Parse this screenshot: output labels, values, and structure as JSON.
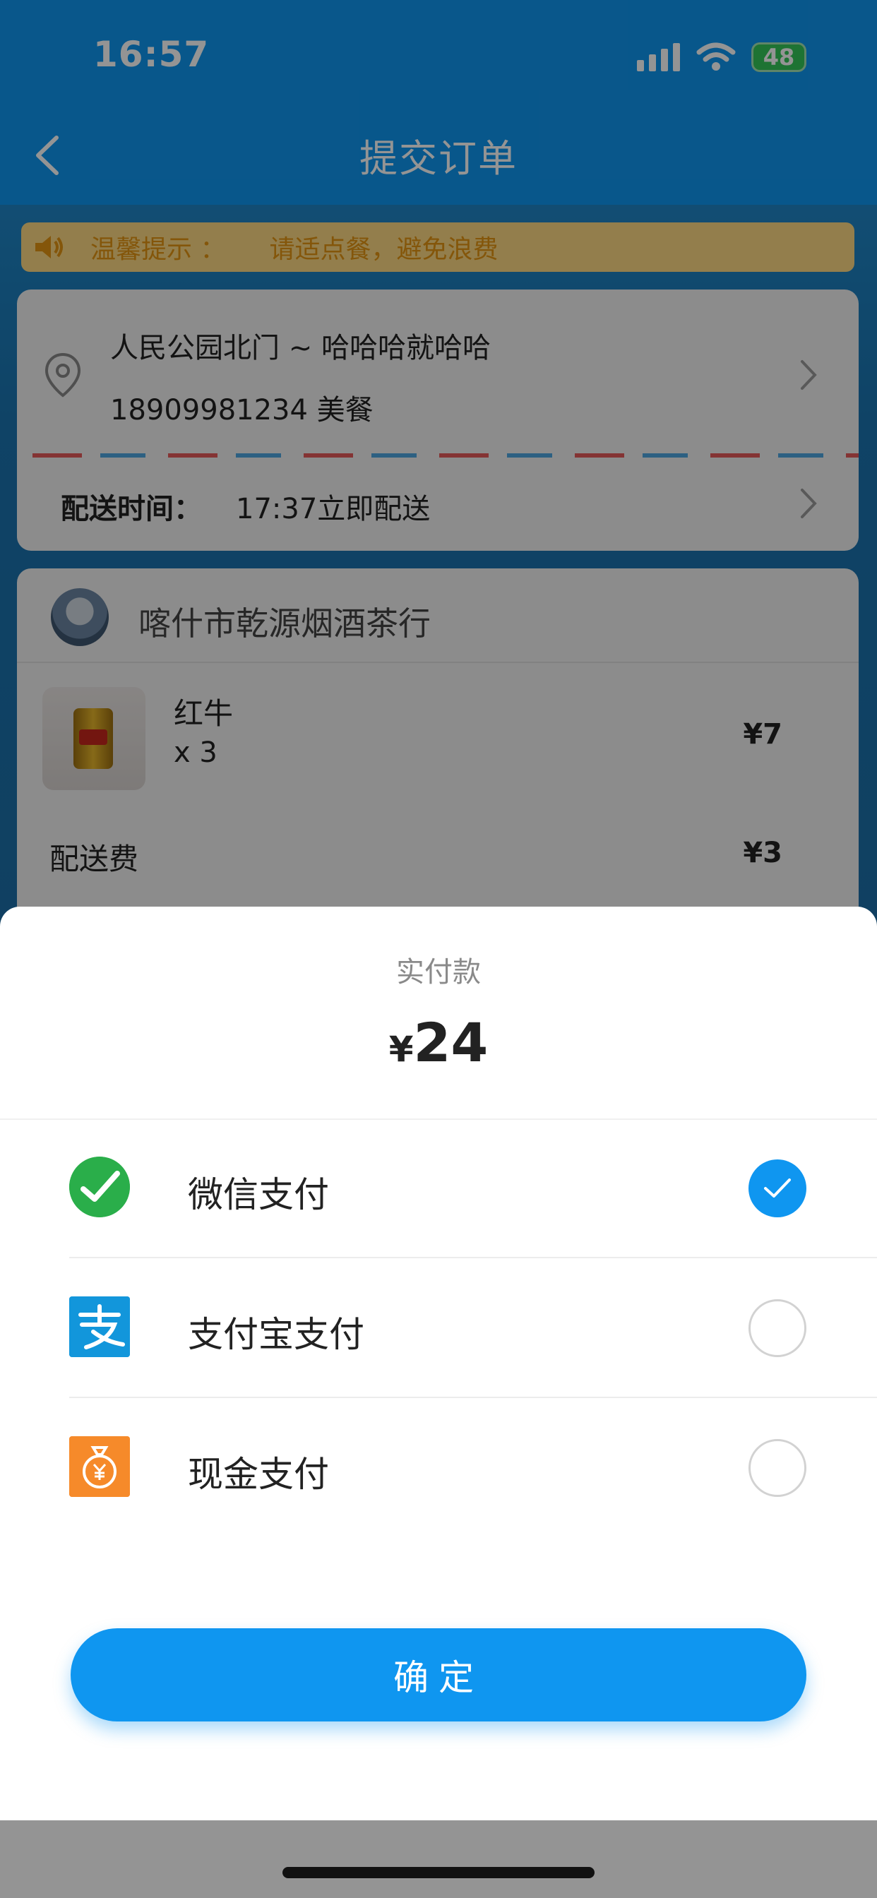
{
  "status_bar": {
    "time": "16:57",
    "battery": "48"
  },
  "header": {
    "title": "提交订单"
  },
  "notice": {
    "label": "温馨提示 ：",
    "message": "请适点餐，避免浪费"
  },
  "address": {
    "line1": "人民公园北门 ~ 哈哈哈就哈哈",
    "line2": "18909981234 美餐",
    "delivery_label": "配送时间：",
    "delivery_value": "17:37立即配送"
  },
  "shop": {
    "name": "喀什市乾源烟酒茶行",
    "product_name": "红牛",
    "product_qty": "x 3",
    "product_price": "¥7",
    "fee_label": "配送费",
    "fee_value": "¥3"
  },
  "payment": {
    "title": "实付款",
    "currency": "¥",
    "amount": "24",
    "options": [
      {
        "label": "微信支付",
        "selected": true
      },
      {
        "label": "支付宝支付",
        "selected": false
      },
      {
        "label": "现金支付",
        "selected": false
      }
    ],
    "confirm_label": "确定"
  },
  "colors": {
    "primary": "#0f96f0",
    "wechat": "#2aae4a",
    "alipay": "#1296db",
    "cash": "#f68a2a"
  }
}
